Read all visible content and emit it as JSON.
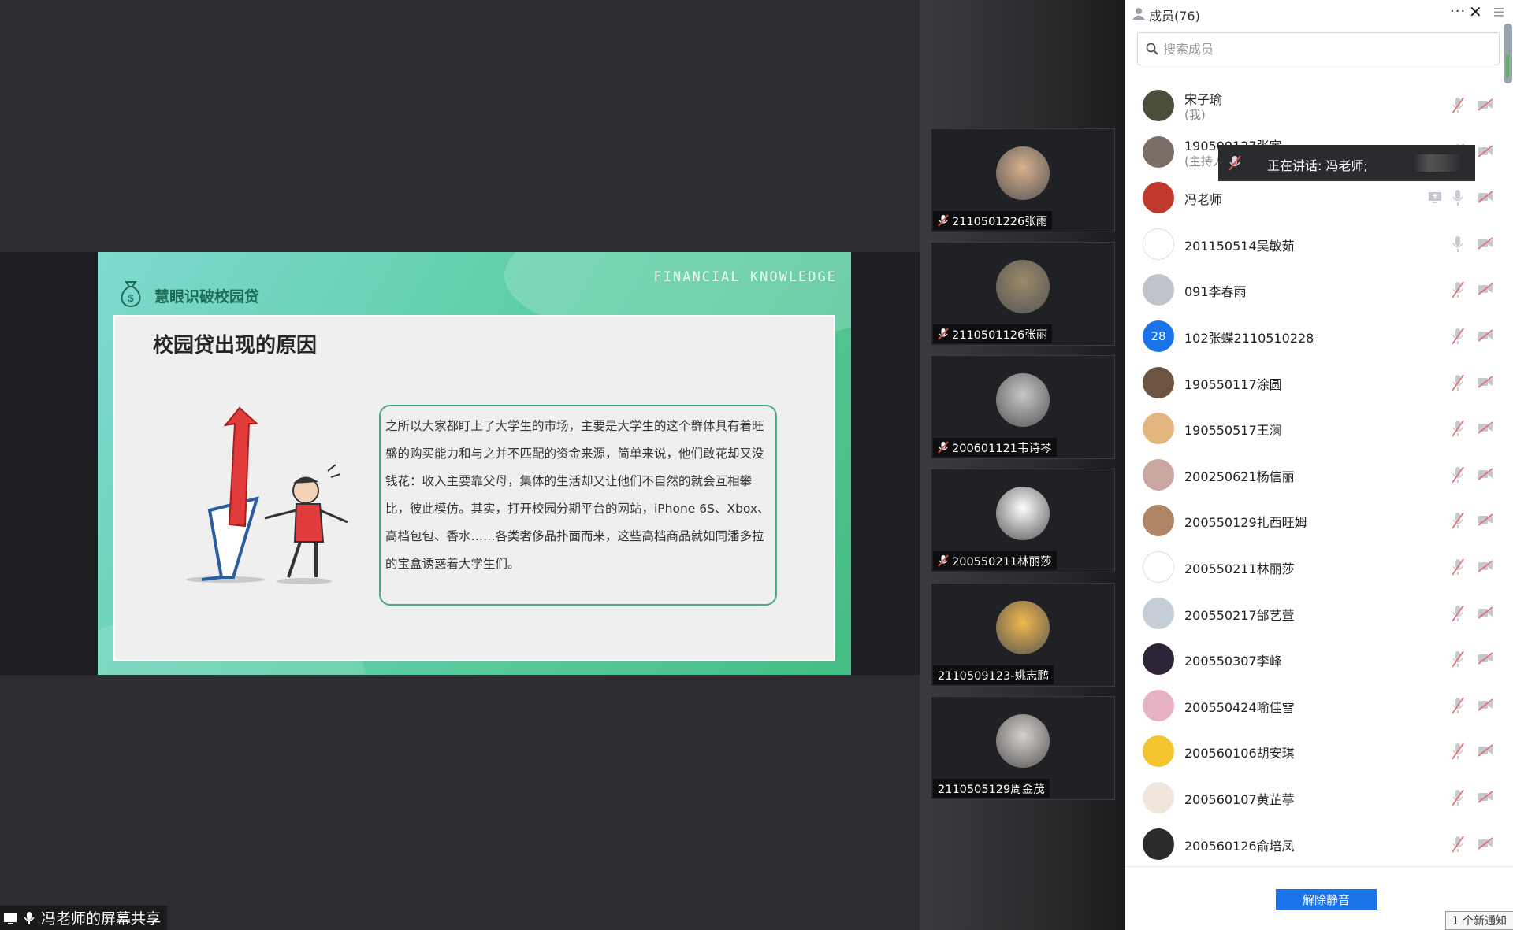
{
  "share": {
    "label": "冯老师的屏幕共享",
    "collapse_icon": "›"
  },
  "slide": {
    "header_title": "慧眼识破校园贷",
    "header_en": "FINANCIAL  KNOWLEDGE",
    "title": "校园贷出现的原因",
    "body": "之所以大家都盯上了大学生的市场，主要是大学生的这个群体具有着旺盛的购买能力和与之并不匹配的资金来源，简单来说，他们敢花却又没钱花：收入主要靠父母，集体的生活却又让他们不自然的就会互相攀比，彼此模仿。其实，打开校园分期平台的网站，iPhone 6S、Xbox、高档包包、香水……各类奢侈品扑面而来，这些高档商品就如同潘多拉的宝盒诱惑着大学生们。"
  },
  "videos": [
    {
      "name": "2110501226张雨",
      "muted": true,
      "color": "#d9b08c"
    },
    {
      "name": "2110501126张丽",
      "muted": true,
      "color": "#9b8a6a"
    },
    {
      "name": "200601121韦诗琴",
      "muted": true,
      "color": "#c8c8c8"
    },
    {
      "name": "200550211林丽莎",
      "muted": true,
      "color": "#ffffff"
    },
    {
      "name": "2110509123-姚志鹏",
      "muted": false,
      "color": "#f2b84b"
    },
    {
      "name": "2110505129周金茂",
      "muted": false,
      "color": "#d8d1cc"
    }
  ],
  "panel": {
    "title": "成员(76)",
    "more": "···",
    "close": "✕",
    "search_placeholder": "搜索成员",
    "members": [
      {
        "name": "宋子瑜",
        "sub": "(我)",
        "avatar_color": "#4a4f3c",
        "mic": "muted"
      },
      {
        "name": "190509127张宇",
        "sub": "(主持人)",
        "avatar_color": "#7a6e66",
        "mic": "muted"
      },
      {
        "name": "冯老师",
        "sub": "",
        "avatar_color": "#c0392b",
        "mic": "on",
        "share": true
      },
      {
        "name": "201150514吴敏茹",
        "sub": "",
        "avatar_color": "#ffffff",
        "mic": "on"
      },
      {
        "name": "091李春雨",
        "sub": "",
        "avatar_color": "#bfc3cc",
        "mic": "muted"
      },
      {
        "name": "102张蝶2110510228",
        "sub": "",
        "avatar_color": "#1a73e8",
        "avatar_text": "28",
        "mic": "muted"
      },
      {
        "name": "190550117涂圆",
        "sub": "",
        "avatar_color": "#6b5442",
        "mic": "muted"
      },
      {
        "name": "190550517王澜",
        "sub": "",
        "avatar_color": "#e3b680",
        "mic": "muted"
      },
      {
        "name": "200250621杨信丽",
        "sub": "",
        "avatar_color": "#caa6a0",
        "mic": "muted"
      },
      {
        "name": "200550129扎西旺姆",
        "sub": "",
        "avatar_color": "#b08466",
        "mic": "muted"
      },
      {
        "name": "200550211林丽莎",
        "sub": "",
        "avatar_color": "#ffffff",
        "mic": "muted"
      },
      {
        "name": "200550217邰艺萱",
        "sub": "",
        "avatar_color": "#c5cdd6",
        "mic": "muted"
      },
      {
        "name": "200550307李峰",
        "sub": "",
        "avatar_color": "#2d2438",
        "mic": "muted"
      },
      {
        "name": "200550424喻佳雪",
        "sub": "",
        "avatar_color": "#e7b3c4",
        "mic": "muted"
      },
      {
        "name": "200560106胡安琪",
        "sub": "",
        "avatar_color": "#f4c430",
        "mic": "muted"
      },
      {
        "name": "200560107黄芷葶",
        "sub": "",
        "avatar_color": "#f1e6dc",
        "mic": "muted"
      },
      {
        "name": "200560126俞培凤",
        "sub": "",
        "avatar_color": "#2b2b2b",
        "mic": "muted"
      }
    ],
    "unmute_label": "解除静音",
    "notify": "1 个新通知"
  },
  "tooltip": {
    "speaking": "正在讲话: 冯老师;"
  }
}
